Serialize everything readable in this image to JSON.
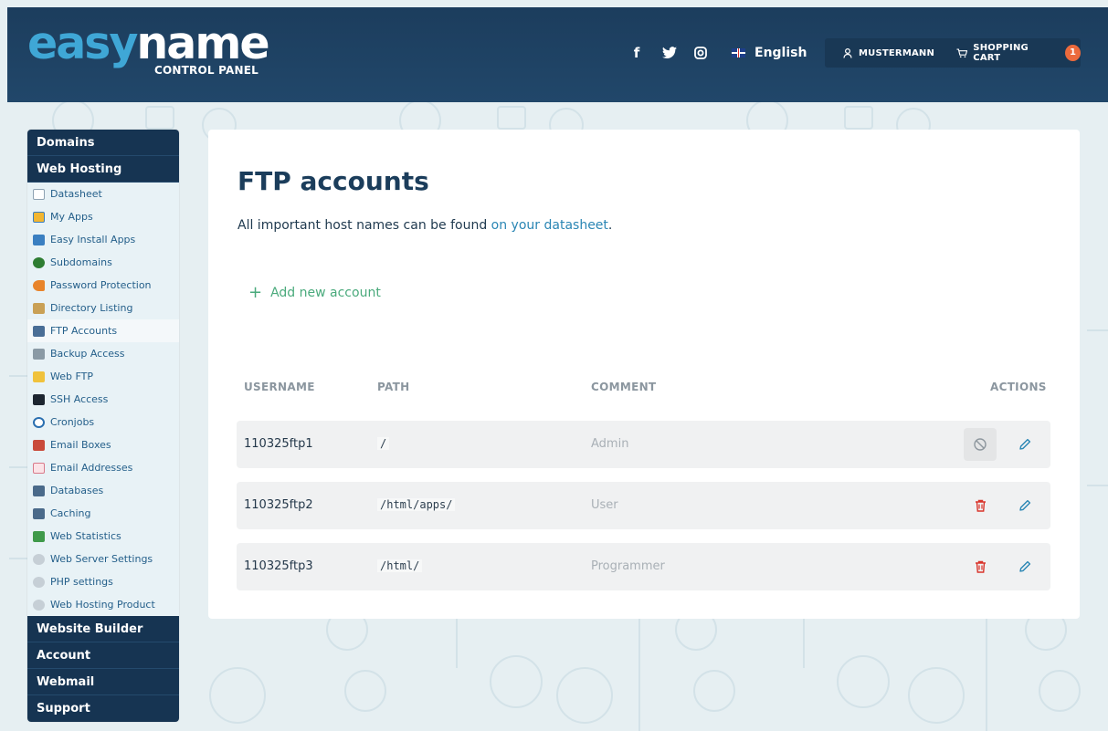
{
  "header": {
    "logo_part1": "easy",
    "logo_part2": "name",
    "logo_sub": "CONTROL PANEL",
    "language": "English",
    "username": "MUSTERMANN",
    "cart_label": "SHOPPING CART",
    "cart_count": "1",
    "social_icons": [
      "facebook-icon",
      "twitter-icon",
      "instagram-icon"
    ]
  },
  "sidebar": {
    "sections_top": [
      "Domains",
      "Web Hosting"
    ],
    "items": [
      {
        "label": "Datasheet",
        "icon": "datasheet-icon",
        "color": "#9bb0c0"
      },
      {
        "label": "My Apps",
        "icon": "apps-icon",
        "color": "#f2b632"
      },
      {
        "label": "Easy Install Apps",
        "icon": "install-icon",
        "color": "#3a7fc1"
      },
      {
        "label": "Subdomains",
        "icon": "globe-icon",
        "color": "#2e7d32"
      },
      {
        "label": "Password Protection",
        "icon": "key-icon",
        "color": "#e8842a"
      },
      {
        "label": "Directory Listing",
        "icon": "folder-open-icon",
        "color": "#c9a055"
      },
      {
        "label": "FTP Accounts",
        "icon": "ftp-icon",
        "color": "#4a6e96"
      },
      {
        "label": "Backup Access",
        "icon": "camera-icon",
        "color": "#8a9aa5"
      },
      {
        "label": "Web FTP",
        "icon": "folder-icon",
        "color": "#f0c23c"
      },
      {
        "label": "SSH Access",
        "icon": "terminal-icon",
        "color": "#1c2530"
      },
      {
        "label": "Cronjobs",
        "icon": "clock-icon",
        "color": "#2a6fb0"
      },
      {
        "label": "Email Boxes",
        "icon": "mailbox-icon",
        "color": "#c94a3a"
      },
      {
        "label": "Email Addresses",
        "icon": "envelope-icon",
        "color": "#d97a8a"
      },
      {
        "label": "Databases",
        "icon": "database-icon",
        "color": "#4a6a8a"
      },
      {
        "label": "Caching",
        "icon": "cache-icon",
        "color": "#4a6a8a"
      },
      {
        "label": "Web Statistics",
        "icon": "statistics-icon",
        "color": "#3f9a4a"
      },
      {
        "label": "Web Server Settings",
        "icon": "settings-icon",
        "color": "#7c8a96"
      },
      {
        "label": "PHP settings",
        "icon": "settings-icon",
        "color": "#7c8a96"
      },
      {
        "label": "Web Hosting Product",
        "icon": "settings-icon",
        "color": "#7c8a96"
      }
    ],
    "sections_bottom": [
      "Website Builder",
      "Account",
      "Webmail",
      "Support"
    ]
  },
  "main": {
    "title": "FTP accounts",
    "intro_text": "All important host names can be found ",
    "intro_link": "on your datasheet",
    "intro_end": ".",
    "add_label": "Add new account",
    "columns": [
      "USERNAME",
      "PATH",
      "COMMENT",
      "ACTIONS"
    ],
    "rows": [
      {
        "username": "110325ftp1",
        "path": "/",
        "comment": "Admin",
        "action": "disabled"
      },
      {
        "username": "110325ftp2",
        "path": "/html/apps/",
        "comment": "User",
        "action": "delete"
      },
      {
        "username": "110325ftp3",
        "path": "/html/",
        "comment": "Programmer",
        "action": "delete"
      }
    ]
  },
  "colors": {
    "header_bg": "#1c3d5d",
    "logo_accent": "#3fa7d6",
    "link": "#2a86b4",
    "add_green": "#4aaa7c",
    "delete_red": "#d9342b",
    "edit_blue": "#2a86b4",
    "badge_orange": "#ec6a3c"
  }
}
